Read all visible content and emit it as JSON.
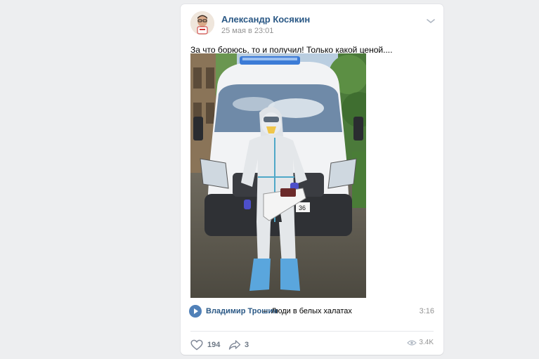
{
  "post": {
    "author": "Александр Косякин",
    "date": "25 мая в 23:01",
    "text": "За что борюсь, то и получил! Только какой ценой....",
    "photo": {
      "plate_text": "36"
    },
    "audio": {
      "artist": "Владимир Трошин",
      "separator": "–",
      "title": "Люди в белых халатах",
      "duration": "3:16"
    },
    "actions": {
      "likes": "194",
      "shares": "3",
      "views": "3.4K"
    }
  },
  "colors": {
    "link": "#2a5885",
    "accent": "#5181b8",
    "muted": "#939393",
    "background": "#edeef0"
  },
  "icons": [
    "chevron-down-icon",
    "play-icon",
    "heart-icon",
    "share-icon",
    "eye-icon"
  ]
}
